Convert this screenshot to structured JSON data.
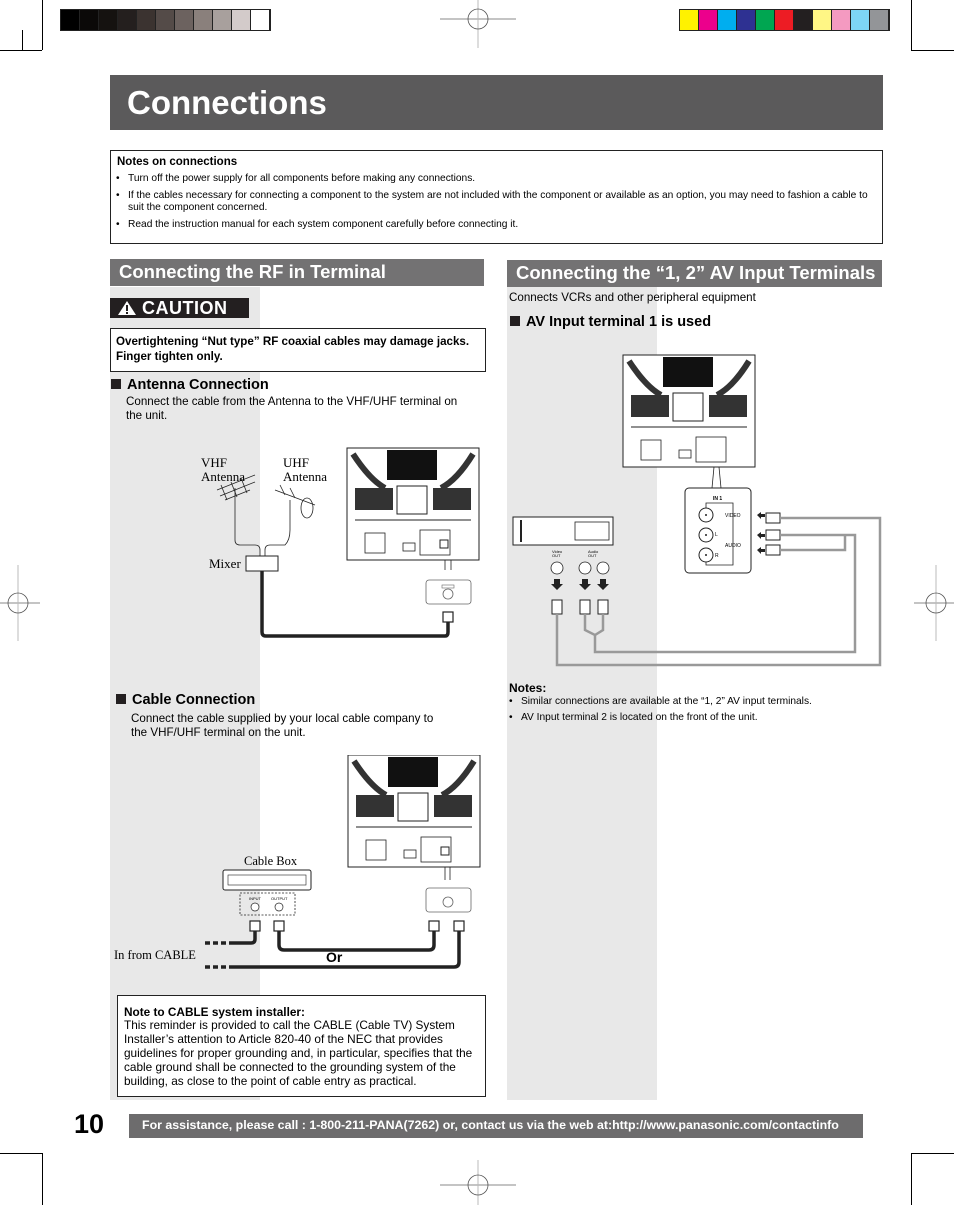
{
  "page": {
    "title": "Connections",
    "page_number": "10",
    "footer_text": "For assistance, please call : 1-800-211-PANA(7262) or, contact us via the web at:http://www.panasonic.com/contactinfo"
  },
  "print_marks": {
    "gray_swatches": [
      "#000000",
      "#0b0908",
      "#151210",
      "#241f1e",
      "#3b3330",
      "#544b48",
      "#6c625f",
      "#8a807c",
      "#a8a09d",
      "#d3cbca",
      "#ffffff"
    ],
    "color_swatches": [
      "#fff200",
      "#ec008c",
      "#00aeef",
      "#2e3192",
      "#00a651",
      "#ed1c24",
      "#231f20",
      "#fff685",
      "#f49ac1",
      "#7dd5f6",
      "#939598"
    ]
  },
  "notes_on_connections": {
    "heading": "Notes on connections",
    "items": [
      "Turn off the power supply for all components before making any connections.",
      "If the cables necessary for connecting a component to the system are not included with the component or available as an option, you may need to fashion a cable to suit the component concerned.",
      "Read the instruction manual for each system component carefully before connecting it."
    ]
  },
  "rf_section": {
    "title": "Connecting the RF in Terminal",
    "caution_label": "CAUTION",
    "caution_text": "Overtightening “Nut type” RF coaxial cables may damage jacks. Finger tighten only.",
    "antenna": {
      "heading": "Antenna Connection",
      "text": "Connect the cable from the Antenna to the VHF/UHF terminal on the unit.",
      "labels": {
        "vhf": [
          "VHF",
          "Antenna"
        ],
        "uhf": [
          "UHF",
          "Antenna"
        ],
        "mixer": "Mixer"
      }
    },
    "cable": {
      "heading": "Cable Connection",
      "text": "Connect the cable supplied by your local cable company to the VHF/UHF terminal on the unit.",
      "labels": {
        "cable_box": "Cable Box",
        "in_from_cable": "In from CABLE",
        "or": "Or",
        "input": "INPUT",
        "output": "OUTPUT"
      }
    },
    "installer_note": {
      "heading": "Note to CABLE system installer:",
      "text": "This reminder is provided to call the CABLE (Cable TV) System Installer’s attention to Article 820-40 of the NEC that provides guidelines for proper grounding and, in particular, specifies that the cable ground shall be connected to the grounding system of the building, as close to the point of cable entry as practical."
    }
  },
  "av_section": {
    "title": "Connecting the “1, 2” AV Input Terminals",
    "subtitle": "Connects VCRs and other peripheral equipment",
    "heading": "AV Input terminal 1 is used",
    "diagram_labels": {
      "in1": "IN 1",
      "video": "VIDEO",
      "audio": "AUDIO",
      "l": "L",
      "r": "R",
      "video_out": [
        "Video",
        "OUT"
      ],
      "audio_out": [
        "Audio",
        "OUT"
      ]
    },
    "notes": {
      "heading": "Notes:",
      "items": [
        "Similar connections are available at the “1, 2” AV input terminals.",
        "AV Input terminal 2 is located on the front of the unit."
      ]
    }
  }
}
